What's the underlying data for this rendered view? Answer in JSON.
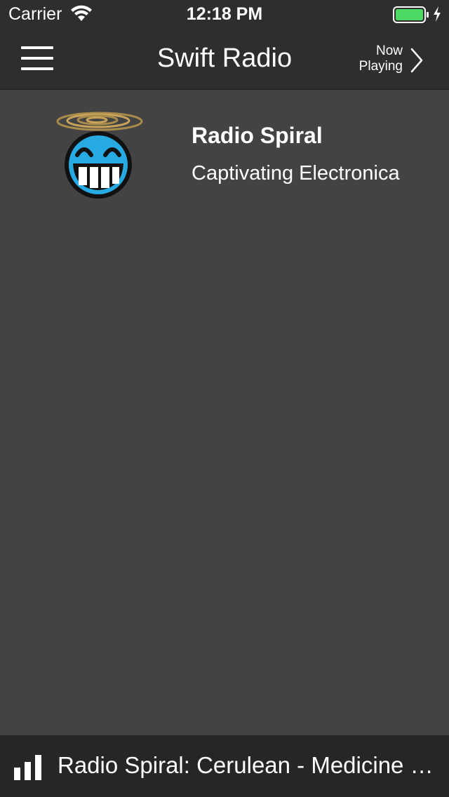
{
  "status_bar": {
    "carrier": "Carrier",
    "time": "12:18 PM",
    "wifi_icon": "wifi-icon",
    "battery_icon": "battery-icon",
    "battery_color": "#4cd964"
  },
  "nav": {
    "menu_icon": "hamburger-menu-icon",
    "title": "Swift Radio",
    "now_playing_line1": "Now",
    "now_playing_line2": "Playing",
    "chevron_icon": "chevron-right-icon"
  },
  "stations": [
    {
      "name": "Radio Spiral",
      "description": "Captivating Electronica",
      "logo_icon": "radio-spiral-logo"
    }
  ],
  "mini_player": {
    "icon": "equalizer-bars-icon",
    "text": "Radio Spiral: Cerulean - Medicine Music"
  },
  "colors": {
    "background": "#434343",
    "nav_background": "#2e2e2f",
    "mini_player_background": "#262627"
  }
}
